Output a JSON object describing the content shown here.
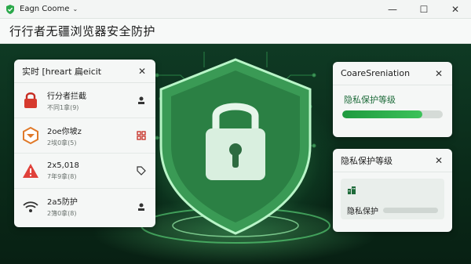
{
  "window": {
    "app_name": "Eagn Coome",
    "caret": "⌄",
    "minimize": "—",
    "maximize": "☐",
    "close": "✕"
  },
  "header": {
    "title": "行行者无疆浏览器安全防护"
  },
  "left_panel": {
    "title": "实时 [hreart 扁eicit",
    "close": "✕",
    "items": [
      {
        "title": "行分者拦截",
        "sub": "不同1拿(9)",
        "icon": "padlock-icon",
        "action_icon": "user-pin-icon"
      },
      {
        "title": "2oe你坡z",
        "sub": "2埃0拿(5)",
        "icon": "shield-warning-icon",
        "action_icon": "grid-icon"
      },
      {
        "title": "2x5,018",
        "sub": "7年9拿(8)",
        "icon": "alert-icon",
        "action_icon": "tag-icon"
      },
      {
        "title": "2a5防护",
        "sub": "2簿0拿(8)",
        "icon": "wifi-icon",
        "action_icon": "user-pin-icon"
      }
    ]
  },
  "right_top_panel": {
    "title": "CoareSreniation",
    "close": "✕",
    "label": "隐私保护等级",
    "progress": 0.8
  },
  "right_bottom_panel": {
    "title": "隐私保护等级",
    "close": "✕",
    "icon": "building-icon",
    "label": "隐私保护"
  },
  "colors": {
    "accent": "#2aa84a",
    "bg_dark": "#0b2a1b",
    "alert_red": "#d63a2e",
    "warn_orange": "#e07a2a"
  }
}
